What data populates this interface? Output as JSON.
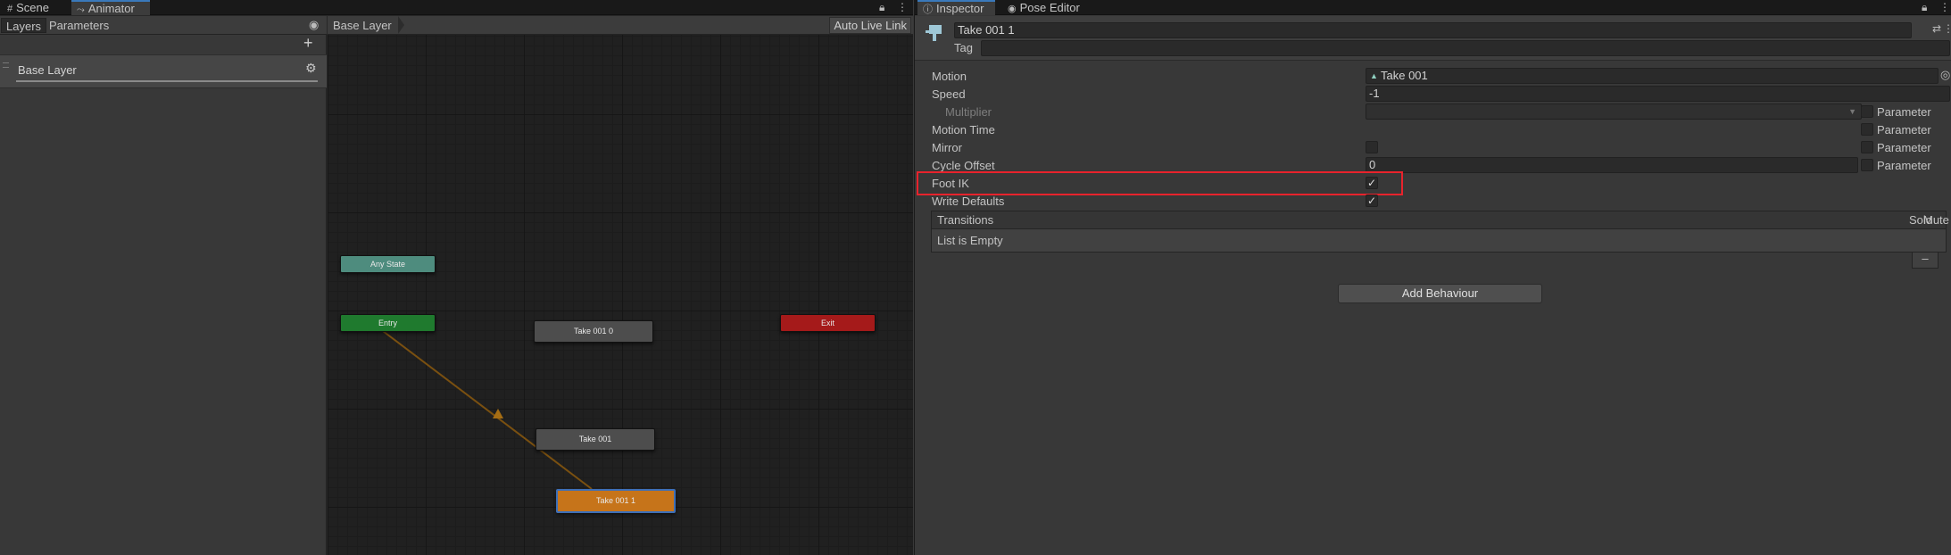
{
  "animator_window": {
    "tabs": [
      {
        "label": "Scene",
        "icon": "grid-icon"
      },
      {
        "label": "Animator",
        "icon": "animator-icon"
      }
    ],
    "layers_panel": {
      "tabs": [
        "Layers",
        "Parameters"
      ],
      "layers": [
        {
          "name": "Base Layer"
        }
      ]
    },
    "graph": {
      "breadcrumb": "Base Layer",
      "auto_live_link": "Auto Live Link",
      "nodes": {
        "any_state": "Any State",
        "entry": "Entry",
        "exit": "Exit",
        "take0010": "Take 001 0",
        "take001": "Take 001",
        "take0011": "Take 001 1"
      },
      "colors": {
        "any_state": "#4e8c7e",
        "entry": "#1f7a2e",
        "exit": "#a51a1a",
        "default_state": "#c6741a",
        "transition": "#8a5a12"
      }
    }
  },
  "inspector": {
    "tabs": [
      {
        "label": "Inspector",
        "icon": "info-icon"
      },
      {
        "label": "Pose Editor",
        "icon": "eye-icon"
      }
    ],
    "state_name": "Take 001 1",
    "tag_label": "Tag",
    "tag_value": "",
    "properties": {
      "motion_label": "Motion",
      "motion_value": "Take 001",
      "speed_label": "Speed",
      "speed_value": "-1",
      "multiplier_label": "Multiplier",
      "motion_time_label": "Motion Time",
      "mirror_label": "Mirror",
      "cycle_offset_label": "Cycle Offset",
      "cycle_offset_value": "0",
      "foot_ik_label": "Foot IK",
      "foot_ik_checked": true,
      "write_defaults_label": "Write Defaults",
      "write_defaults_checked": true,
      "parameter_label": "Parameter"
    },
    "transitions": {
      "title": "Transitions",
      "solo": "Solo",
      "mute": "Mute",
      "empty_text": "List is Empty",
      "remove_label": "–"
    },
    "add_behaviour": "Add Behaviour",
    "highlight_color": "#e8232c"
  }
}
